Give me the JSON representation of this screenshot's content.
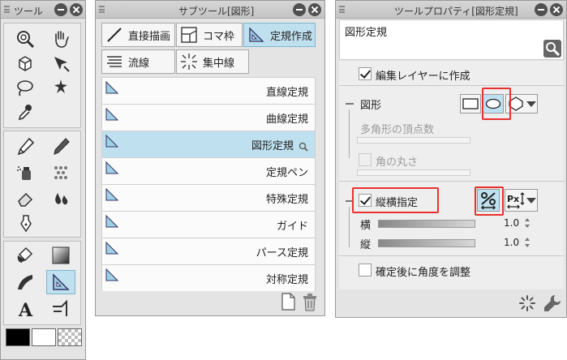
{
  "tool_panel": {
    "title": "ツール",
    "icons": [
      "magnifier-icon",
      "hand-icon",
      "object-icon",
      "move-icon",
      "lasso-icon",
      "magic-wand-icon",
      "eyedropper-icon",
      "pen-icon",
      "pencil-icon",
      "airbrush-icon",
      "decoration-icon",
      "eraser-icon",
      "blend-icon",
      "ink-icon",
      "fill-icon",
      "gradient-icon",
      "figure-icon",
      "ruler-icon",
      "text-icon",
      "balloon-icon"
    ],
    "active_tool": "ruler-icon",
    "colors": {
      "main": "#000000",
      "sub": "#ffffff",
      "transparent": "checker"
    }
  },
  "subtool_panel": {
    "title": "サブツール[図形]",
    "tabs": [
      {
        "label": "直接描画",
        "icon": "line-draw-icon",
        "selected": false
      },
      {
        "label": "コマ枠",
        "icon": "frame-icon",
        "selected": false
      },
      {
        "label": "定規作成",
        "icon": "ruler-create-icon",
        "selected": true
      },
      {
        "label": "流線",
        "icon": "streamline-icon",
        "selected": false
      },
      {
        "label": "集中線",
        "icon": "focus-line-icon",
        "selected": false
      }
    ],
    "items": [
      {
        "label": "直線定規",
        "selected": false
      },
      {
        "label": "曲線定規",
        "selected": false
      },
      {
        "label": "図形定規",
        "selected": true
      },
      {
        "label": "定規ペン",
        "selected": false
      },
      {
        "label": "特殊定規",
        "selected": false
      },
      {
        "label": "ガイド",
        "selected": false
      },
      {
        "label": "パース定規",
        "selected": false
      },
      {
        "label": "対称定規",
        "selected": false
      }
    ]
  },
  "property_panel": {
    "title": "ツールプロパティ[図形定規]",
    "subtitle": "図形定規",
    "edit_layer": {
      "label": "編集レイヤーに作成",
      "checked": true
    },
    "shape": {
      "label": "図形",
      "options": [
        "rectangle-icon",
        "ellipse-icon",
        "polygon-icon"
      ],
      "selected": "ellipse-icon"
    },
    "polygon_vertices": {
      "label": "多角形の頂点数"
    },
    "corner_round": {
      "label": "角の丸さ",
      "checked": false
    },
    "aspect": {
      "label": "縦横指定",
      "checked": true
    },
    "width": {
      "label": "横",
      "value": "1.0"
    },
    "height": {
      "label": "縦",
      "value": "1.0"
    },
    "adjust_angle": {
      "label": "確定後に角度を調整",
      "checked": false
    }
  }
}
